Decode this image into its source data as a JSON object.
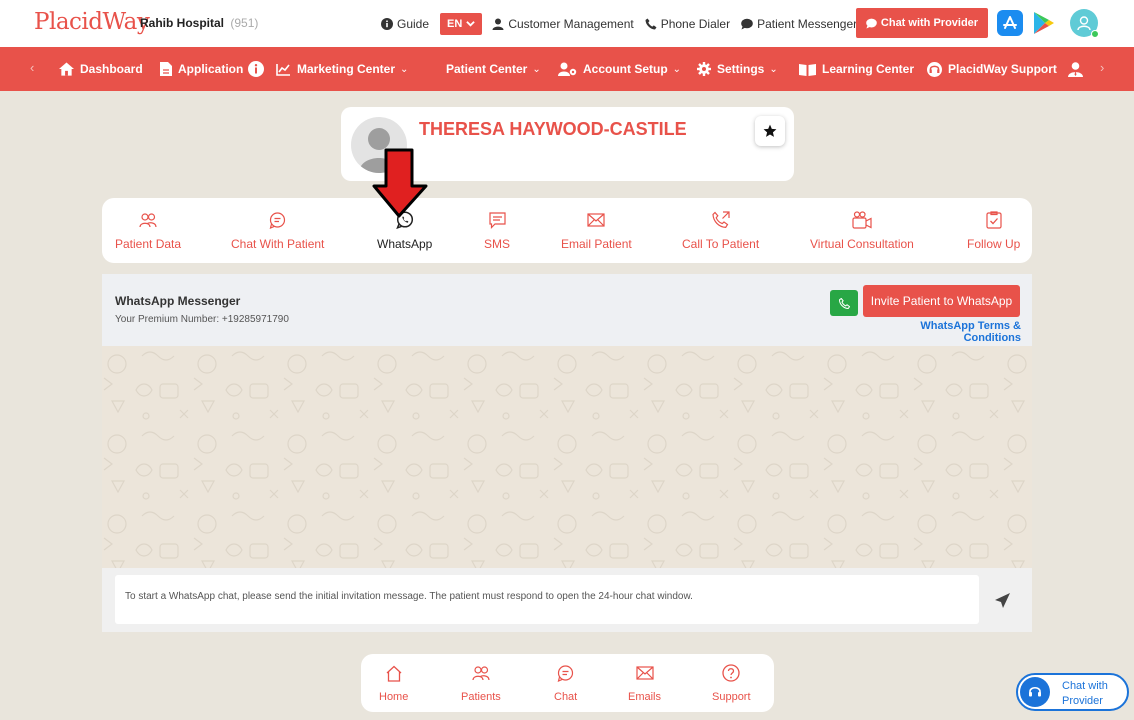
{
  "brand": {
    "logo": "PlacidWay",
    "hospital": "Rahib Hospital",
    "hospital_count": "(951)"
  },
  "topbar": {
    "guide": "Guide",
    "lang": "EN",
    "customer_management": "Customer Management",
    "phone_dialer": "Phone Dialer",
    "patient_messenger": "Patient Messenger",
    "chat_with_provider": "Chat with Provider"
  },
  "nav": {
    "dashboard": "Dashboard",
    "application": "Application",
    "marketing_center": "Marketing Center",
    "patient_center": "Patient Center",
    "account_setup": "Account Setup",
    "settings": "Settings",
    "learning_center": "Learning Center",
    "support": "PlacidWay Support"
  },
  "profile": {
    "name": "THERESA HAYWOOD-CASTILE"
  },
  "tabs": [
    {
      "label": "Patient Data",
      "icon": "users-icon"
    },
    {
      "label": "Chat With Patient",
      "icon": "chat-bubble-icon"
    },
    {
      "label": "WhatsApp",
      "icon": "whatsapp-icon",
      "active": true
    },
    {
      "label": "SMS",
      "icon": "sms-icon"
    },
    {
      "label": "Email Patient",
      "icon": "envelope-icon"
    },
    {
      "label": "Call To Patient",
      "icon": "phone-outgoing-icon"
    },
    {
      "label": "Virtual Consultation",
      "icon": "video-icon"
    },
    {
      "label": "Follow Up",
      "icon": "checklist-icon"
    }
  ],
  "whatsapp": {
    "title": "WhatsApp Messenger",
    "number": "Your Premium Number: +19285971790",
    "invite": "Invite Patient to WhatsApp",
    "terms": "WhatsApp Terms & Conditions",
    "input_text": "To start a WhatsApp chat, please send the initial invitation message. The patient must respond to open the 24-hour chat window."
  },
  "bottom_nav": [
    {
      "label": "Home",
      "icon": "home-icon"
    },
    {
      "label": "Patients",
      "icon": "users-icon"
    },
    {
      "label": "Chat",
      "icon": "chat-bubble-icon"
    },
    {
      "label": "Emails",
      "icon": "envelope-icon"
    },
    {
      "label": "Support",
      "icon": "help-icon"
    }
  ],
  "chat_float": {
    "line1": "Chat with",
    "line2": "Provider"
  },
  "colors": {
    "brand": "#e8524a",
    "link": "#1b73d9",
    "whatsapp_green": "#28a745",
    "background": "#e9e5dc"
  }
}
